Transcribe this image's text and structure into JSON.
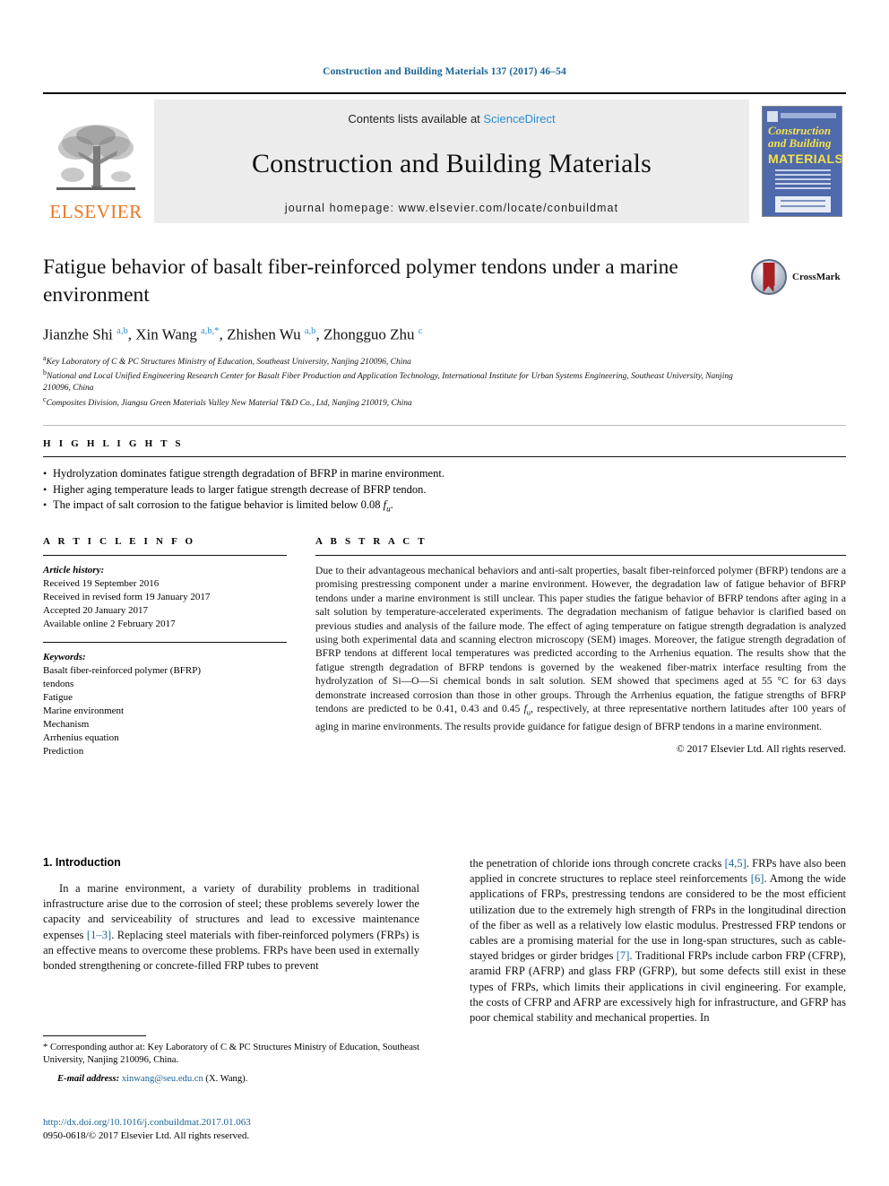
{
  "running_head": "Construction and Building Materials 137 (2017) 46–54",
  "masthead": {
    "publisher": "ELSEVIER",
    "contents_prefix": "Contents lists available at ",
    "contents_link": "ScienceDirect",
    "journal_title": "Construction and Building Materials",
    "homepage": "journal homepage: www.elsevier.com/locate/conbuildmat",
    "cover": {
      "line1": "Construction",
      "line2": "and Building",
      "line3": "MATERIALS"
    }
  },
  "article": {
    "title": "Fatigue behavior of basalt fiber-reinforced polymer tendons under a marine environment",
    "crossmark_label": "CrossMark",
    "authors_html": "Jianzhe Shi <sup>a,b</sup>, Xin Wang <sup>a,b,*</sup>, Zhishen Wu <sup>a,b</sup>, Zhongguo Zhu <sup>c</sup>",
    "affiliations": [
      {
        "mark": "a",
        "text": "Key Laboratory of C & PC Structures Ministry of Education, Southeast University, Nanjing 210096, China"
      },
      {
        "mark": "b",
        "text": "National and Local Unified Engineering Research Center for Basalt Fiber Production and Application Technology, International Institute for Urban Systems Engineering, Southeast University, Nanjing 210096, China"
      },
      {
        "mark": "c",
        "text": "Composites Division, Jiangsu Green Materials Valley New Material T&D Co., Ltd, Nanjing 210019, China"
      }
    ]
  },
  "highlights": {
    "heading": "H I G H L I G H T S",
    "items": [
      "Hydrolyzation dominates fatigue strength degradation of BFRP in marine environment.",
      "Higher aging temperature leads to larger fatigue strength decrease of BFRP tendon.",
      "The impact of salt corrosion to the fatigue behavior is limited below 0.08 fu."
    ]
  },
  "article_info": {
    "heading": "A R T I C L E   I N F O",
    "history_label": "Article history:",
    "history": [
      "Received 19 September 2016",
      "Received in revised form 19 January 2017",
      "Accepted 20 January 2017",
      "Available online 2 February 2017"
    ],
    "keywords_label": "Keywords:",
    "keywords": [
      "Basalt fiber-reinforced polymer (BFRP)",
      "tendons",
      "Fatigue",
      "Marine environment",
      "Mechanism",
      "Arrhenius equation",
      "Prediction"
    ]
  },
  "abstract": {
    "heading": "A B S T R A C T",
    "text": "Due to their advantageous mechanical behaviors and anti-salt properties, basalt fiber-reinforced polymer (BFRP) tendons are a promising prestressing component under a marine environment. However, the degradation law of fatigue behavior of BFRP tendons under a marine environment is still unclear. This paper studies the fatigue behavior of BFRP tendons after aging in a salt solution by temperature-accelerated experiments. The degradation mechanism of fatigue behavior is clarified based on previous studies and analysis of the failure mode. The effect of aging temperature on fatigue strength degradation is analyzed using both experimental data and scanning electron microscopy (SEM) images. Moreover, the fatigue strength degradation of BFRP tendons at different local temperatures was predicted according to the Arrhenius equation. The results show that the fatigue strength degradation of BFRP tendons is governed by the weakened fiber-matrix interface resulting from the hydrolyzation of Si—O—Si chemical bonds in salt solution. SEM showed that specimens aged at 55 °C for 63 days demonstrate increased corrosion than those in other groups. Through the Arrhenius equation, the fatigue strengths of BFRP tendons are predicted to be 0.41, 0.43 and 0.45 fu, respectively, at three representative northern latitudes after 100 years of aging in marine environments. The results provide guidance for fatigue design of BFRP tendons in a marine environment.",
    "copyright": "© 2017 Elsevier Ltd. All rights reserved."
  },
  "body": {
    "section_title": "1. Introduction",
    "left_paragraph_html": "In a marine environment, a variety of durability problems in traditional infrastructure arise due to the corrosion of steel; these problems severely lower the capacity and serviceability of structures and lead to excessive maintenance expenses <span class=\"ref\">[1–3]</span>. Replacing steel materials with fiber-reinforced polymers (FRPs) is an effective means to overcome these problems. FRPs have been used in externally bonded strengthening or concrete-filled FRP tubes to prevent",
    "right_paragraph_html": "the penetration of chloride ions through concrete cracks <span class=\"ref\">[4,5]</span>. FRPs have also been applied in concrete structures to replace steel reinforcements <span class=\"ref\">[6]</span>. Among the wide applications of FRPs, prestressing tendons are considered to be the most efficient utilization due to the extremely high strength of FRPs in the longitudinal direction of the fiber as well as a relatively low elastic modulus. Prestressed FRP tendons or cables are a promising material for the use in long-span structures, such as cable-stayed bridges or girder bridges <span class=\"ref\">[7]</span>. Traditional FRPs include carbon FRP (CFRP), aramid FRP (AFRP) and glass FRP (GFRP), but some defects still exist in these types of FRPs, which limits their applications in civil engineering. For example, the costs of CFRP and AFRP are excessively high for infrastructure, and GFRP has poor chemical stability and mechanical properties. In"
  },
  "footnote": {
    "corresponding_html": "* Corresponding author at: Key Laboratory of C &amp; PC Structures Ministry of Education, Southeast University, Nanjing 210096, China.",
    "email_label": "E-mail address:",
    "email": "xinwang@seu.edu.cn",
    "email_owner": "(X. Wang)."
  },
  "imprint": {
    "doi": "http://dx.doi.org/10.1016/j.conbuildmat.2017.01.063",
    "issn_line": "0950-0618/© 2017 Elsevier Ltd. All rights reserved."
  },
  "colors": {
    "link": "#1a6496",
    "sciencedirect": "#2b8fd4",
    "elsevier_orange": "#E87722",
    "cover_blue": "#4f6aab",
    "cover_yellow": "#f5e14b"
  }
}
